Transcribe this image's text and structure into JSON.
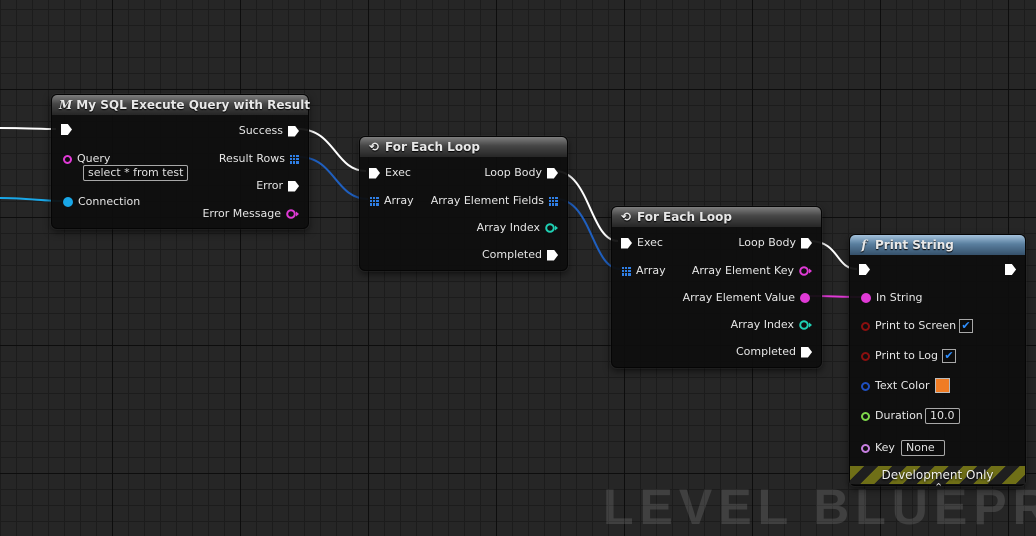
{
  "watermark": "LEVEL BLUEPRIN",
  "colors": {
    "exec_wire": "#ffffff",
    "array_wire": "#1f5fbf",
    "string_pin": "#e03ad6",
    "struct_pin": "#19a7e8",
    "int_pin": "#1fd1b4",
    "bool_pin": "#8b0f0f",
    "color_pin": "#1f4fbf",
    "float_pin": "#7dd64a",
    "name_pin": "#c77fe0",
    "text_color_value": "#f07c24"
  },
  "sql_node": {
    "title": "My SQL Execute Query with Result",
    "icon": "macro-icon",
    "pins": {
      "query_label": "Query",
      "query_value": "select * from test",
      "connection": "Connection",
      "success": "Success",
      "result_rows": "Result Rows",
      "error": "Error",
      "error_message": "Error Message"
    }
  },
  "loop1": {
    "title": "For Each Loop",
    "icon": "loop-icon",
    "pins": {
      "exec": "Exec",
      "array": "Array",
      "loop_body": "Loop Body",
      "array_element": "Array Element Fields",
      "array_index": "Array Index",
      "completed": "Completed"
    }
  },
  "loop2": {
    "title": "For Each Loop",
    "icon": "loop-icon",
    "pins": {
      "exec": "Exec",
      "array": "Array",
      "loop_body": "Loop Body",
      "array_element_key": "Array Element Key",
      "array_element_value": "Array Element Value",
      "array_index": "Array Index",
      "completed": "Completed"
    }
  },
  "print_node": {
    "title": "Print String",
    "icon": "function-icon",
    "pins": {
      "in_string": "In String",
      "print_to_screen": "Print to Screen",
      "print_to_screen_checked": true,
      "print_to_log": "Print to Log",
      "print_to_log_checked": true,
      "text_color": "Text Color",
      "duration": "Duration",
      "duration_value": "10.0",
      "key": "Key",
      "key_value": "None"
    },
    "footer": "Development Only"
  }
}
